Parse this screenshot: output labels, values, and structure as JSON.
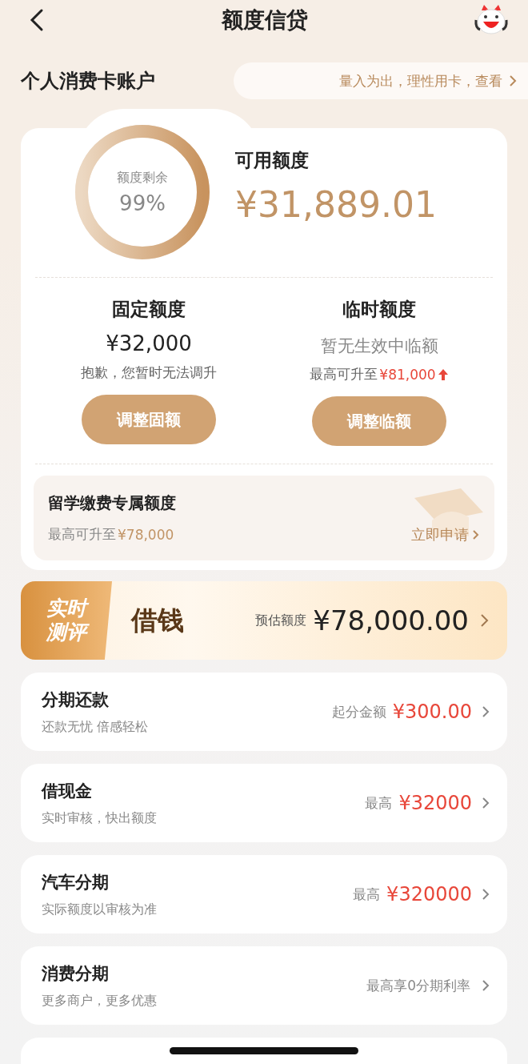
{
  "header": {
    "title": "额度信贷"
  },
  "account": {
    "title": "个人消费卡账户",
    "notice": "量入为出，理性用卡，查看"
  },
  "quota": {
    "ring_label": "额度剩余",
    "ring_percent": "99%",
    "available_label": "可用额度",
    "available_amount": "¥31,889.01",
    "fixed": {
      "title": "固定额度",
      "amount": "¥32,000",
      "note": "抱歉，您暂时无法调升",
      "button": "调整固额"
    },
    "temp": {
      "title": "临时额度",
      "amount": "暂无生效中临额",
      "note_prefix": "最高可升至",
      "note_amount": "¥81,000",
      "button": "调整临额"
    },
    "study": {
      "title": "留学缴费专属额度",
      "note_prefix": "最高可升至",
      "note_amount": "¥78,000",
      "link": "立即申请"
    }
  },
  "loan": {
    "badge_line1": "实时",
    "badge_line2": "测评",
    "title": "借钱",
    "estimate_label": "预估额度",
    "estimate_amount": "¥78,000.00"
  },
  "services": [
    {
      "title": "分期还款",
      "subtitle": "还款无忧 倍感轻松",
      "label": "起分金额",
      "amount": "¥300.00"
    },
    {
      "title": "借现金",
      "subtitle": "实时审核，快出额度",
      "label": "最高",
      "amount": "¥32000"
    },
    {
      "title": "汽车分期",
      "subtitle": "实际额度以审核为准",
      "label": "最高",
      "amount": "¥320000"
    },
    {
      "title": "消费分期",
      "subtitle": "更多商户，更多优惠",
      "label": "最高享0分期利率"
    }
  ]
}
